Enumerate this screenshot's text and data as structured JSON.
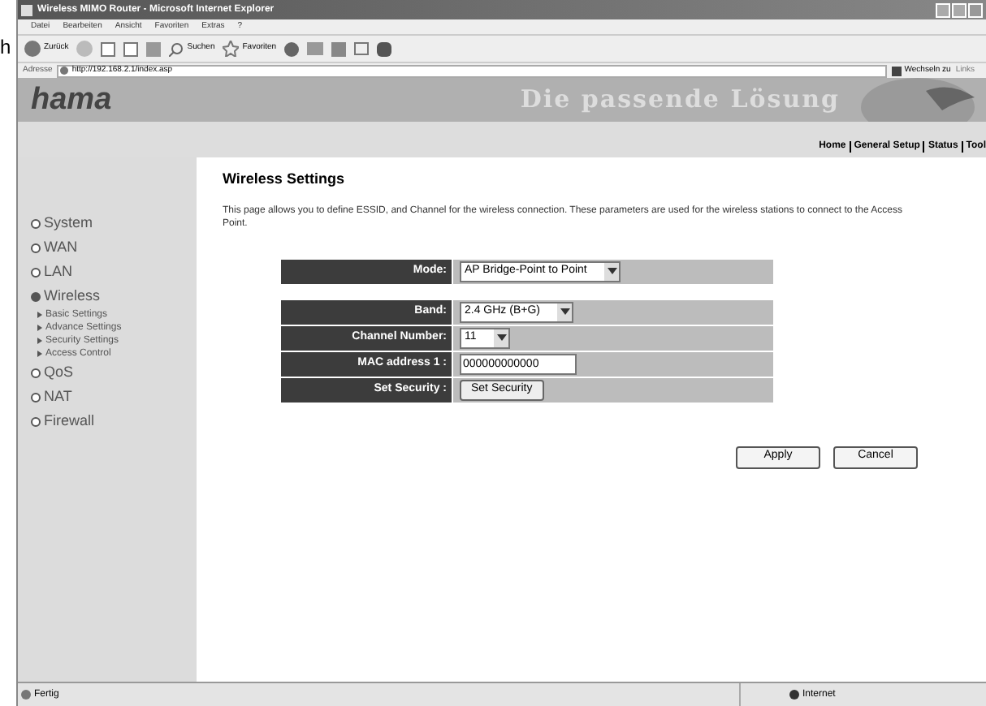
{
  "stray_text": "h",
  "window": {
    "title": "Wireless MIMO Router - Microsoft Internet Explorer"
  },
  "menu": [
    "Datei",
    "Bearbeiten",
    "Ansicht",
    "Favoriten",
    "Extras",
    "?"
  ],
  "toolbar": {
    "back": "Zurück",
    "search": "Suchen",
    "favorites": "Favoriten"
  },
  "address_bar": {
    "label": "Adresse",
    "value": "http://192.168.2.1/index.asp",
    "go": "Wechseln zu",
    "links": "Links"
  },
  "banner": {
    "logo": "hama",
    "slogan": "Die passende Lösung"
  },
  "nav_links": [
    "Home",
    "General Setup",
    "Status",
    "Tool"
  ],
  "sidebar": {
    "items": [
      {
        "label": "System",
        "selected": false
      },
      {
        "label": "WAN",
        "selected": false
      },
      {
        "label": "LAN",
        "selected": false
      },
      {
        "label": "Wireless",
        "selected": true,
        "children": [
          {
            "label": "Basic Settings"
          },
          {
            "label": "Advance Settings"
          },
          {
            "label": "Security Settings"
          },
          {
            "label": "Access Control"
          }
        ]
      },
      {
        "label": "QoS",
        "selected": false
      },
      {
        "label": "NAT",
        "selected": false
      },
      {
        "label": "Firewall",
        "selected": false
      }
    ]
  },
  "content": {
    "title": "Wireless Settings",
    "description": "This page allows you to define ESSID, and Channel for the wireless connection. These parameters are used for the wireless stations to connect to the Access Point.",
    "mode_rows": [
      {
        "label": "Mode:",
        "kind": "select",
        "value": "AP Bridge-Point to Point"
      }
    ],
    "rows": [
      {
        "label": "Band:",
        "kind": "select",
        "value": "2.4 GHz (B+G)"
      },
      {
        "label": "Channel Number:",
        "kind": "select",
        "value": "11"
      },
      {
        "label": "MAC address 1 :",
        "kind": "input",
        "value": "000000000000"
      },
      {
        "label": "Set Security :",
        "kind": "button",
        "value": "Set Security"
      }
    ],
    "buttons": [
      "Apply",
      "Cancel"
    ]
  },
  "status_bar": {
    "left": "Fertig",
    "zone": "Internet"
  }
}
